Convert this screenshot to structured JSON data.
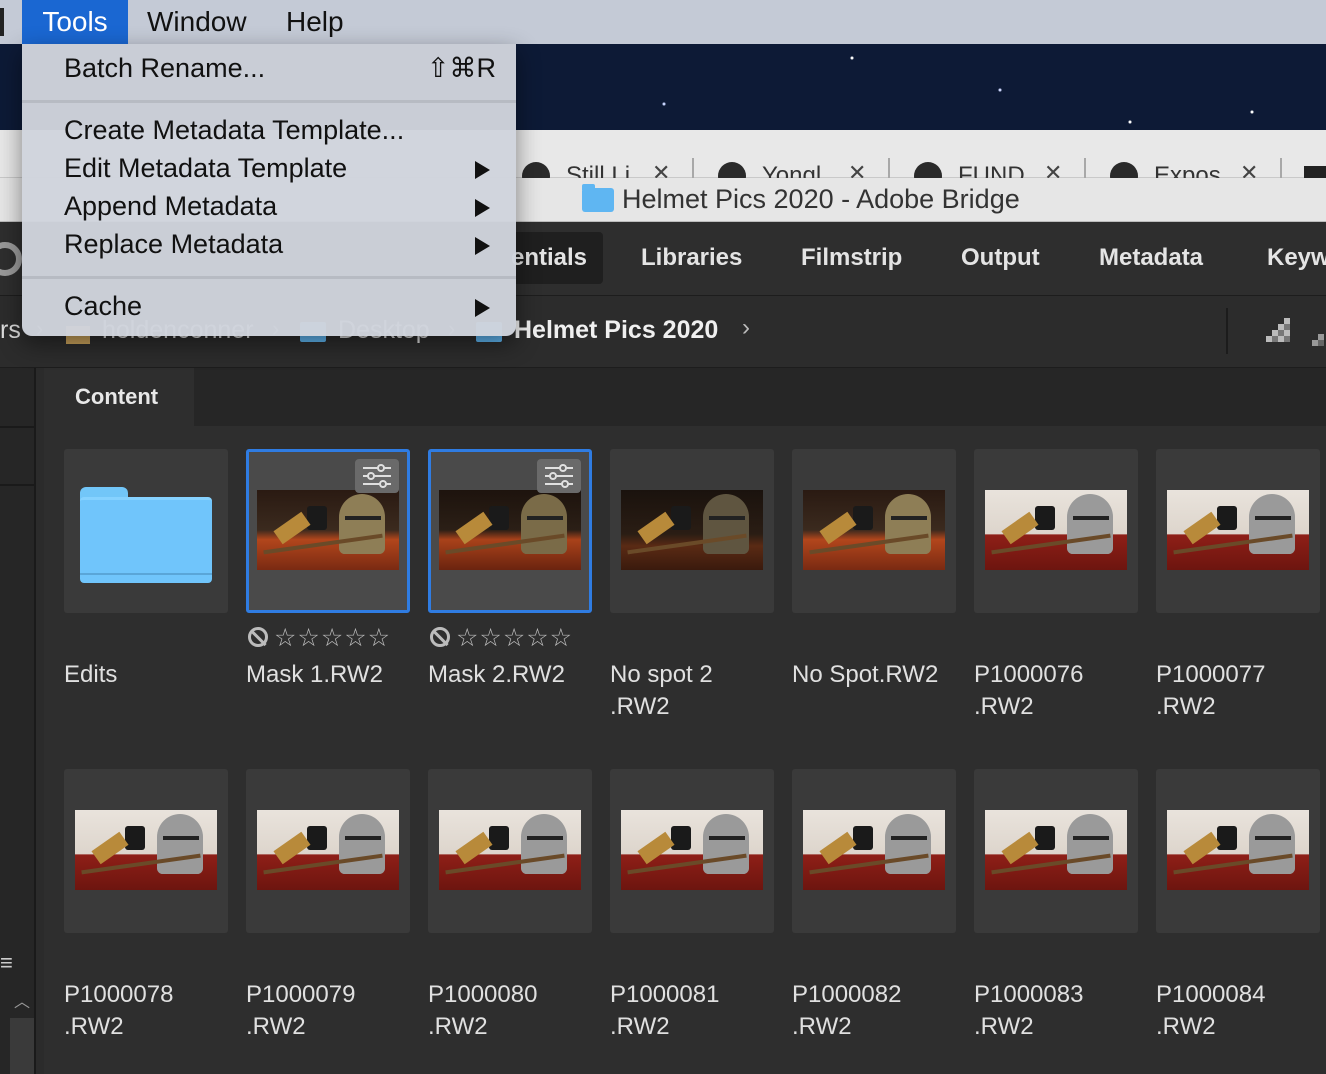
{
  "menubar": {
    "items": [
      "Tools",
      "Window",
      "Help"
    ],
    "active": "Tools",
    "accent": "#1a67d2"
  },
  "tools_menu": {
    "batch_rename": {
      "label": "Batch Rename...",
      "shortcut": "⇧⌘R"
    },
    "create_template": "Create Metadata Template...",
    "edit_template": "Edit Metadata Template",
    "append_metadata": "Append Metadata",
    "replace_metadata": "Replace Metadata",
    "cache": "Cache"
  },
  "browser_tabs": [
    {
      "label": "Still Li"
    },
    {
      "label": "Yongl"
    },
    {
      "label": "FUND"
    },
    {
      "label": "Expos"
    }
  ],
  "window": {
    "title": "Helmet Pics 2020 - Adobe Bridge"
  },
  "workspaces": {
    "active": "Essentials",
    "active_visible": "entials",
    "items": [
      "Libraries",
      "Filmstrip",
      "Output",
      "Metadata",
      "Keyw"
    ]
  },
  "path": {
    "partial_left": "rs",
    "home": "holdenconner",
    "desktop": "Desktop",
    "current": "Helmet Pics 2020"
  },
  "content": {
    "tab_label": "Content",
    "items": [
      {
        "name": "Edits",
        "kind": "folder",
        "selected": false,
        "rating": null,
        "badge": false
      },
      {
        "name": "Mask 1.RW2",
        "kind": "photo",
        "tone": "dark",
        "selected": true,
        "rating": 0,
        "badge": true
      },
      {
        "name": "Mask 2.RW2",
        "kind": "photo",
        "tone": "darker",
        "selected": true,
        "rating": 0,
        "badge": true
      },
      {
        "name": "No spot 2\n.RW2",
        "kind": "photo",
        "tone": "dim",
        "selected": false,
        "rating": null,
        "badge": false
      },
      {
        "name": "No Spot.RW2",
        "kind": "photo",
        "tone": "dark",
        "selected": false,
        "rating": null,
        "badge": false
      },
      {
        "name": "P1000076\n.RW2",
        "kind": "photo",
        "tone": "light",
        "selected": false,
        "rating": null,
        "badge": false
      },
      {
        "name": "P1000077\n.RW2",
        "kind": "photo",
        "tone": "light",
        "selected": false,
        "rating": null,
        "badge": false
      },
      {
        "name": "P1000078\n.RW2",
        "kind": "photo",
        "tone": "light",
        "selected": false,
        "rating": null,
        "badge": false
      },
      {
        "name": "P1000079\n.RW2",
        "kind": "photo",
        "tone": "light",
        "selected": false,
        "rating": null,
        "badge": false
      },
      {
        "name": "P1000080\n.RW2",
        "kind": "photo",
        "tone": "light",
        "selected": false,
        "rating": null,
        "badge": false
      },
      {
        "name": "P1000081\n.RW2",
        "kind": "photo",
        "tone": "light",
        "selected": false,
        "rating": null,
        "badge": false
      },
      {
        "name": "P1000082\n.RW2",
        "kind": "photo",
        "tone": "light",
        "selected": false,
        "rating": null,
        "badge": false
      },
      {
        "name": "P1000083\n.RW2",
        "kind": "photo",
        "tone": "light",
        "selected": false,
        "rating": null,
        "badge": false
      },
      {
        "name": "P1000084\n.RW2",
        "kind": "photo",
        "tone": "light",
        "selected": false,
        "rating": null,
        "badge": false
      }
    ],
    "rating_text": "☆☆☆☆☆",
    "selection_color": "#2f7ce2"
  }
}
